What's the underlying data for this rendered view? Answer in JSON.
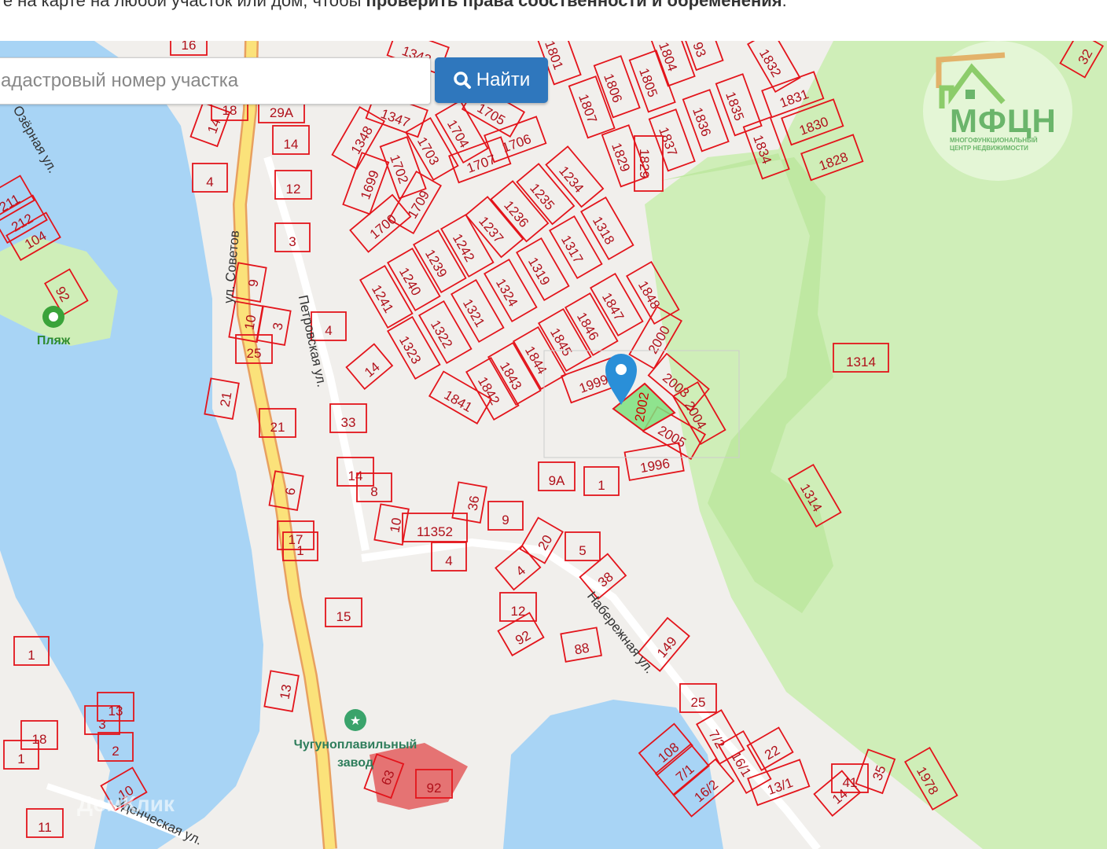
{
  "intro": {
    "text": "те на карте на любой участок или дом, чтобы ",
    "bold": "проверить права собственности и обременения",
    "end": "."
  },
  "search": {
    "placeholder": "адастровый номер участка",
    "button_label": "Найти",
    "button_icon": "search-icon"
  },
  "logo": {
    "title": "МФЦН",
    "line1": "МНОГОФУНКЦИОНАЛЬНЫЙ",
    "line2": "ЦЕНТР НЕДВИЖИМОСТИ"
  },
  "colors": {
    "water": "#a8d4f5",
    "park": "#cfeeb8",
    "ground": "#f1efec",
    "parcel_border": "#e3141b",
    "selected_parcel": "#7ee07e",
    "button": "#2f77bd",
    "pin": "#2a8fd8"
  },
  "map": {
    "selected_parcel": "2002",
    "parcels": [
      "16",
      "1342",
      "1801",
      "1804",
      "1806",
      "1805",
      "1807",
      "1832",
      "1831",
      "1830",
      "1828",
      "1835",
      "1836",
      "1834",
      "1837",
      "1829",
      "1829",
      "1347",
      "1705",
      "1704",
      "1348",
      "1703",
      "1706",
      "1707",
      "1702",
      "1699",
      "1709",
      "1700",
      "1234",
      "1235",
      "1236",
      "1237",
      "1318",
      "1317",
      "1242",
      "1239",
      "1319",
      "1240",
      "1324",
      "1241",
      "1321",
      "1322",
      "1323",
      "1848",
      "1847",
      "1846",
      "1845",
      "1844",
      "1843",
      "1842",
      "1841",
      "2000",
      "1999",
      "2003",
      "2004",
      "2005",
      "1996",
      "1314",
      "1314",
      "1",
      "9A",
      "14",
      "12",
      "4",
      "14",
      "3",
      "29A",
      "18",
      "4",
      "3",
      "10",
      "9",
      "25",
      "14",
      "33",
      "21",
      "21",
      "14",
      "8",
      "10",
      "11352",
      "36",
      "9",
      "6",
      "17",
      "1",
      "4",
      "20",
      "5",
      "38",
      "4",
      "12",
      "92",
      "88",
      "149",
      "15",
      "13",
      "25",
      "108",
      "7/1",
      "7/2",
      "16/1",
      "16/2",
      "22",
      "13/1",
      "14",
      "41",
      "35",
      "1978",
      "1",
      "3",
      "2",
      "1",
      "10",
      "11",
      "13",
      "18",
      "92",
      "211",
      "212",
      "104",
      "32",
      "93",
      "63",
      "92"
    ],
    "streets": [
      "Озёрная ул.",
      "ул. Советов",
      "Петровская ул.",
      "Набережная ул.",
      "Уденческая ул."
    ],
    "pois": [
      "Пляж",
      "Чугуноплавильный",
      "завод"
    ],
    "watermark": "ДомКлик"
  }
}
